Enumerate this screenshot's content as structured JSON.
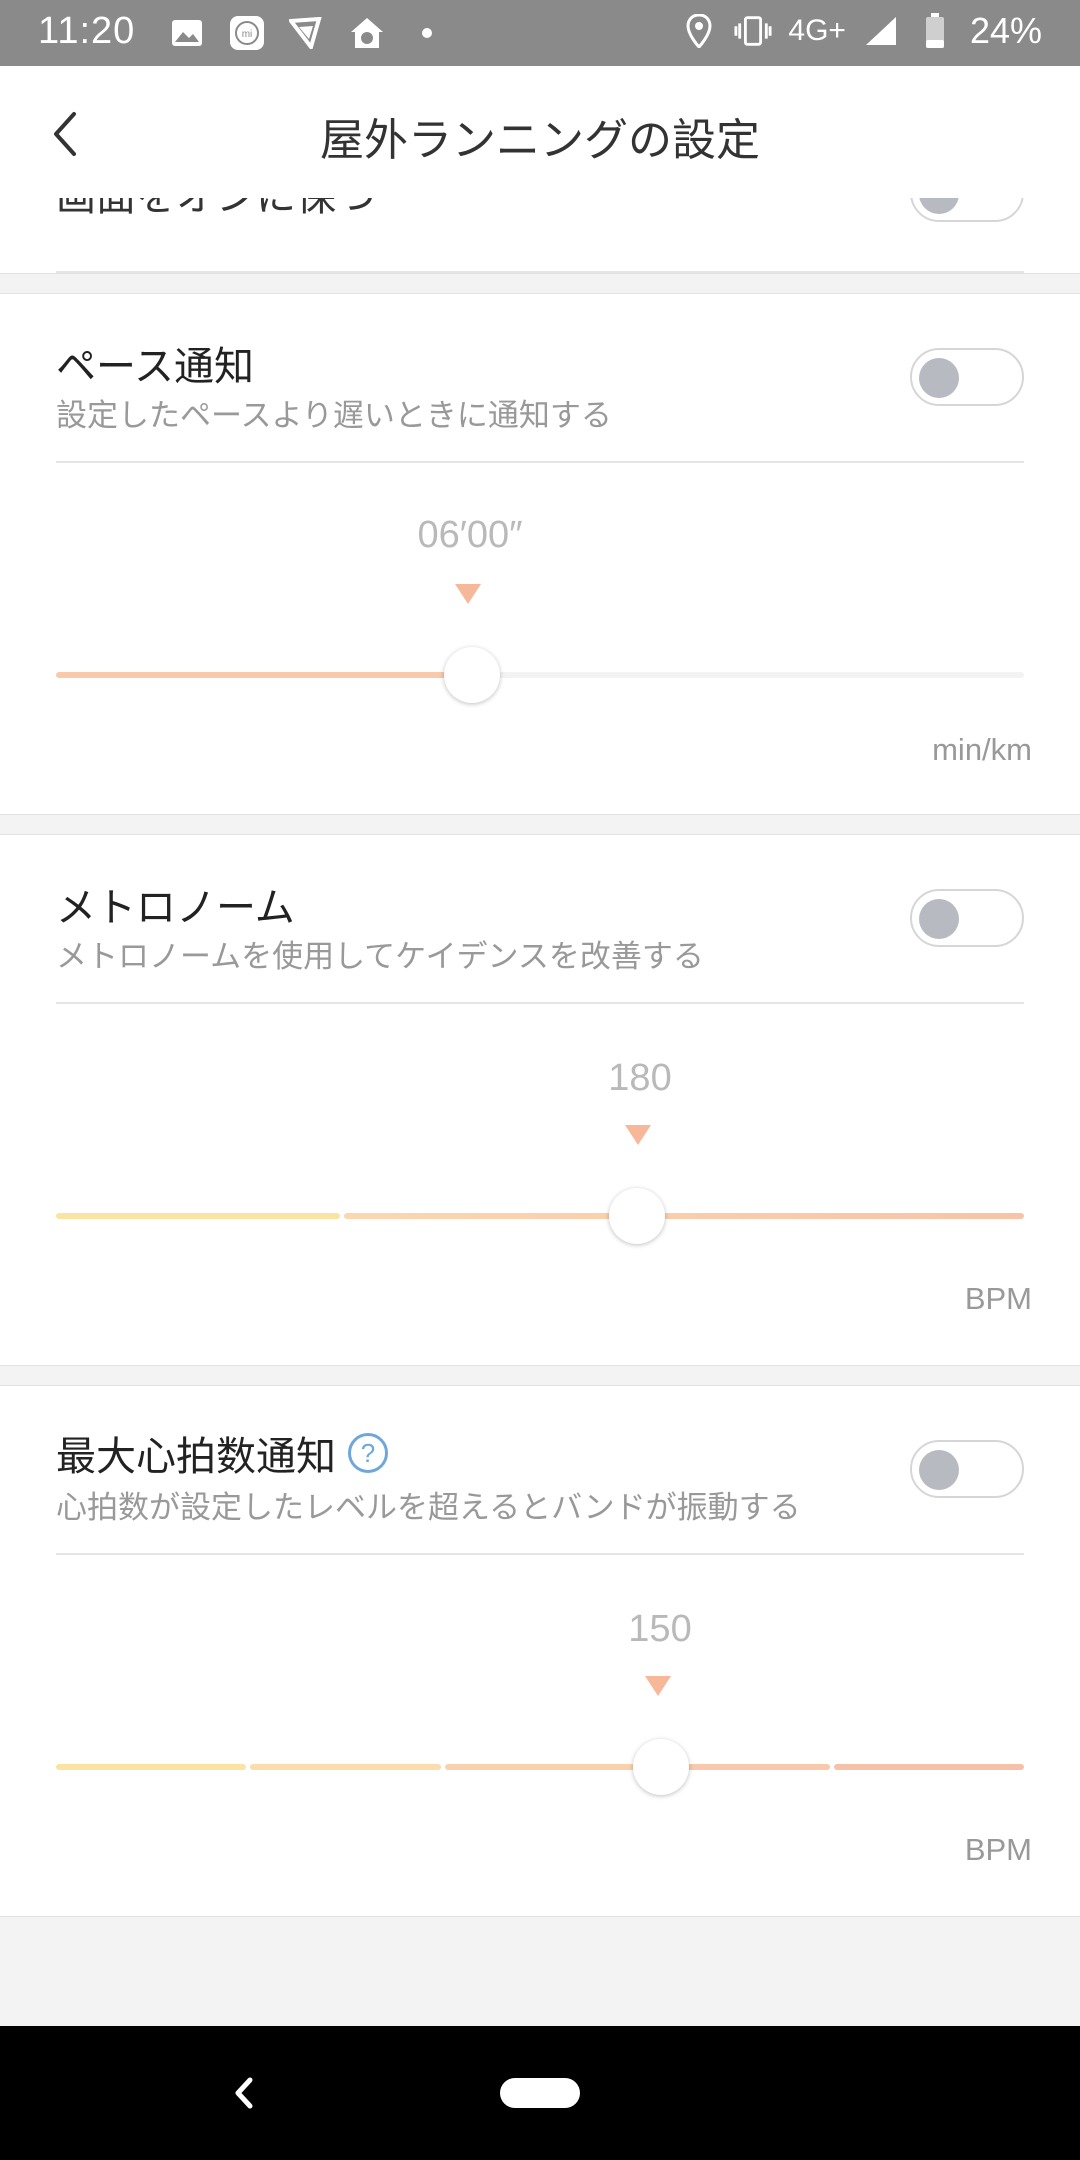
{
  "status_bar": {
    "time": "11:20",
    "network": "4G+",
    "battery": "24%",
    "icons": [
      "gallery-icon",
      "mi-icon",
      "app-icon",
      "home-icon",
      "dot-icon",
      "location-icon",
      "vibrate-icon",
      "signal-icon",
      "battery-icon"
    ]
  },
  "header": {
    "title": "屋外ランニングの設定"
  },
  "keep_screen_on": {
    "label": "画面をオンに保つ",
    "enabled": false
  },
  "pace_alert": {
    "title": "ペース通知",
    "description": "設定したペースより遅いときに通知する",
    "enabled": false,
    "value_label": "06′00″",
    "unit": "min/km",
    "position_fraction": 0.43,
    "colors": {
      "active": "#f8c9aa",
      "inactive": "#f3f3f3"
    }
  },
  "metronome": {
    "title": "メトロノーム",
    "description": "メトロノームを使用してケイデンスを改善する",
    "enabled": false,
    "value_label": "180",
    "unit": "BPM",
    "position_fraction": 0.6,
    "segment_colors": [
      "#fbe3a2",
      "#fbd7b0",
      "#f8c3a8"
    ]
  },
  "max_heart_rate": {
    "title": "最大心拍数通知",
    "description": "心拍数が設定したレベルを超えるとバンドが振動する",
    "enabled": false,
    "value_label": "150",
    "unit": "BPM",
    "position_fraction": 0.625,
    "segment_colors": [
      "#fbe3a2",
      "#fbdcab",
      "#f9d2ad",
      "#f8c9aa",
      "#f7c0a8"
    ]
  }
}
